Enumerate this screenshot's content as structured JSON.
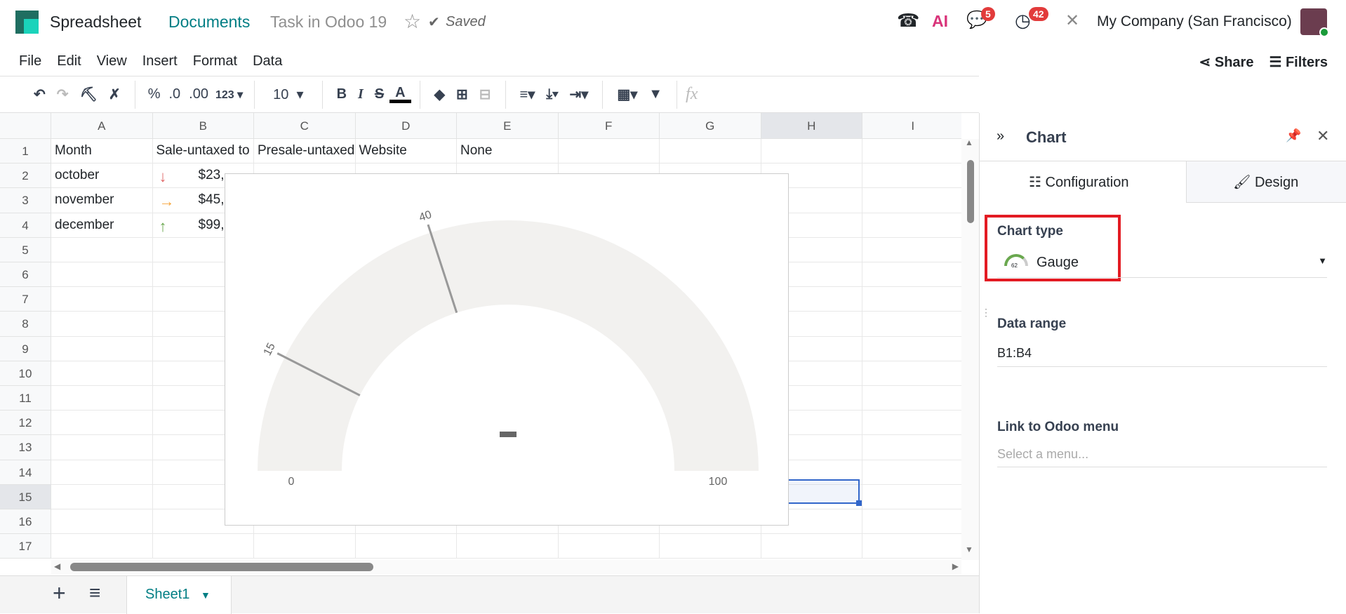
{
  "header": {
    "app": "Spreadsheet",
    "breadcrumb": "Documents",
    "doc_title": "Task in Odoo 19",
    "saved": "Saved",
    "messages_count": "5",
    "activities_count": "42",
    "company": "My Company (San Francisco)"
  },
  "menu": [
    "File",
    "Edit",
    "View",
    "Insert",
    "Format",
    "Data"
  ],
  "actions": {
    "share": "Share",
    "filters": "Filters"
  },
  "toolbar": {
    "percent": "%",
    "dec_less": ".0",
    "dec_more": ".00",
    "format": "123",
    "font_size": "10",
    "fx": "fx"
  },
  "columns": [
    "A",
    "B",
    "C",
    "D",
    "E",
    "F",
    "G",
    "H",
    "I"
  ],
  "rows": [
    "1",
    "2",
    "3",
    "4",
    "5",
    "6",
    "7",
    "8",
    "9",
    "10",
    "11",
    "12",
    "13",
    "14",
    "15",
    "16",
    "17"
  ],
  "cells": [
    [
      "Month",
      "Sale-untaxed to",
      "Presale-untaxed",
      "Website",
      "None"
    ],
    [
      "october",
      "$23,"
    ],
    [
      "november",
      "$45,"
    ],
    [
      "december",
      "$99,"
    ]
  ],
  "trend_icons": [
    {
      "icon": "arrow-down",
      "color": "#e06666"
    },
    {
      "icon": "arrow-right",
      "color": "#f6a53c"
    },
    {
      "icon": "arrow-up",
      "color": "#6aa84f"
    }
  ],
  "chart_data": {
    "type": "gauge",
    "min": 0,
    "max": 100,
    "value": null,
    "value_label": "-",
    "thresholds": [
      15,
      40
    ],
    "tick_labels": [
      "0",
      "15",
      "40",
      "100"
    ],
    "band_color": "#f2f1ef"
  },
  "sheet": {
    "tab": "Sheet1"
  },
  "panel": {
    "title": "Chart",
    "tabs": [
      "Configuration",
      "Design"
    ],
    "chart_type_label": "Chart type",
    "chart_type_value": "Gauge",
    "gauge_icon_text": "62",
    "data_range_label": "Data range",
    "data_range_value": "B1:B4",
    "link_label": "Link to Odoo menu",
    "link_placeholder": "Select a menu..."
  }
}
